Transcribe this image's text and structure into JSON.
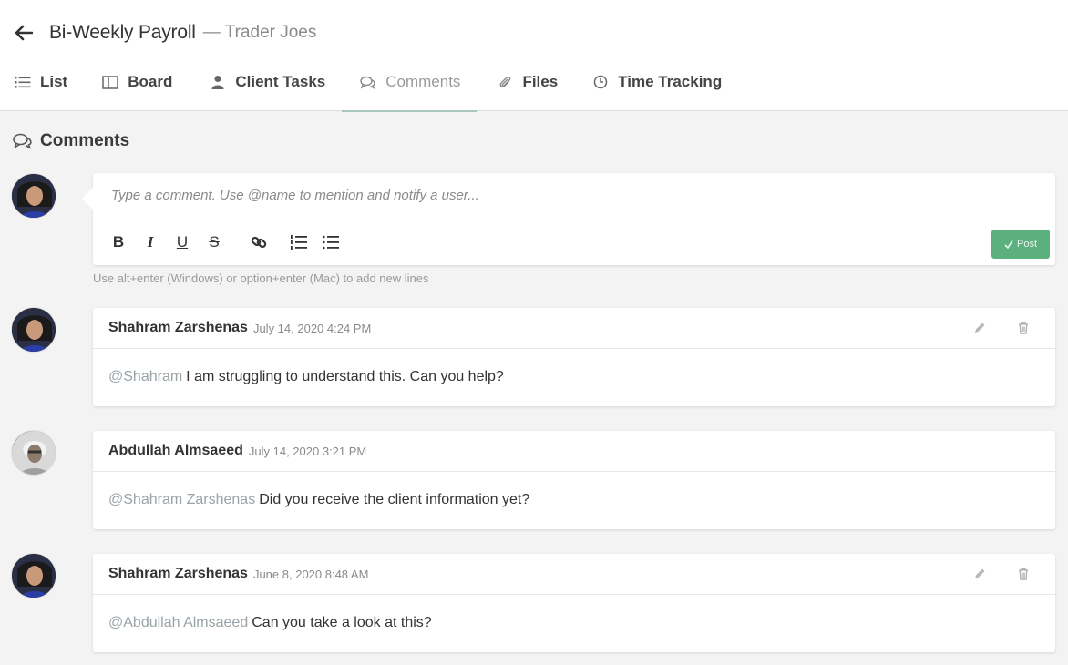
{
  "header": {
    "back_icon": "arrow-left-icon",
    "title": "Bi-Weekly Payroll",
    "subtitle": "— Trader Joes"
  },
  "tabs": [
    {
      "label": "List",
      "icon": "list-icon"
    },
    {
      "label": "Board",
      "icon": "board-icon"
    },
    {
      "label": "Client Tasks",
      "icon": "user-icon"
    },
    {
      "label": "Comments",
      "icon": "comments-icon",
      "active": true
    },
    {
      "label": "Files",
      "icon": "paperclip-icon"
    },
    {
      "label": "Time Tracking",
      "icon": "clock-icon"
    }
  ],
  "section": {
    "title": "Comments",
    "icon": "comments-icon"
  },
  "composer": {
    "placeholder": "Type a comment. Use @name to mention and notify a user...",
    "toolbar": [
      "B",
      "I",
      "U",
      "S"
    ],
    "post_label": "Post",
    "hint": "Use alt+enter (Windows) or option+enter (Mac) to add new lines"
  },
  "comments": [
    {
      "author": "Shahram Zarshenas",
      "time": "July 14, 2020 4:24 PM",
      "mention": "@Shahram",
      "text": "I am struggling to understand this. Can you help?",
      "editable": true
    },
    {
      "author": "Abdullah Almsaeed",
      "time": "July 14, 2020 3:21 PM",
      "mention": "@Shahram Zarshenas",
      "text": "Did you receive the client information yet?",
      "editable": false
    },
    {
      "author": "Shahram Zarshenas",
      "time": "June 8, 2020 8:48 AM",
      "mention": "@Abdullah Almsaeed",
      "text": "Can you take a look at this?",
      "editable": true
    }
  ],
  "colors": {
    "accent": "#5cb07e",
    "tab_underline": "#a8c8bf",
    "mention": "#9aa3a8"
  }
}
